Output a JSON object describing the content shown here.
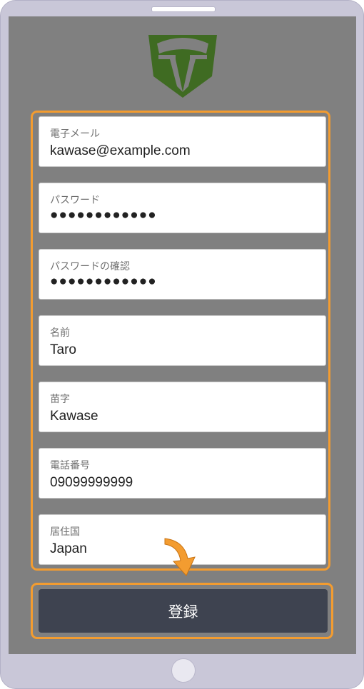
{
  "brand": {
    "logo_color": "#3f6b22",
    "accent_color": "#f39c30"
  },
  "form": {
    "fields": [
      {
        "label": "電子メール",
        "value": "kawase@example.com"
      },
      {
        "label": "パスワード",
        "value": "●●●●●●●●●●●●"
      },
      {
        "label": "パスワードの確認",
        "value": "●●●●●●●●●●●●"
      },
      {
        "label": "名前",
        "value": "Taro"
      },
      {
        "label": "苗字",
        "value": "Kawase"
      },
      {
        "label": "電話番号",
        "value": "09099999999"
      },
      {
        "label": "居住国",
        "value": "Japan"
      }
    ]
  },
  "actions": {
    "register_label": "登録"
  },
  "icons": {
    "logo": "shield-logo-icon",
    "pointer": "curved-arrow-icon"
  }
}
